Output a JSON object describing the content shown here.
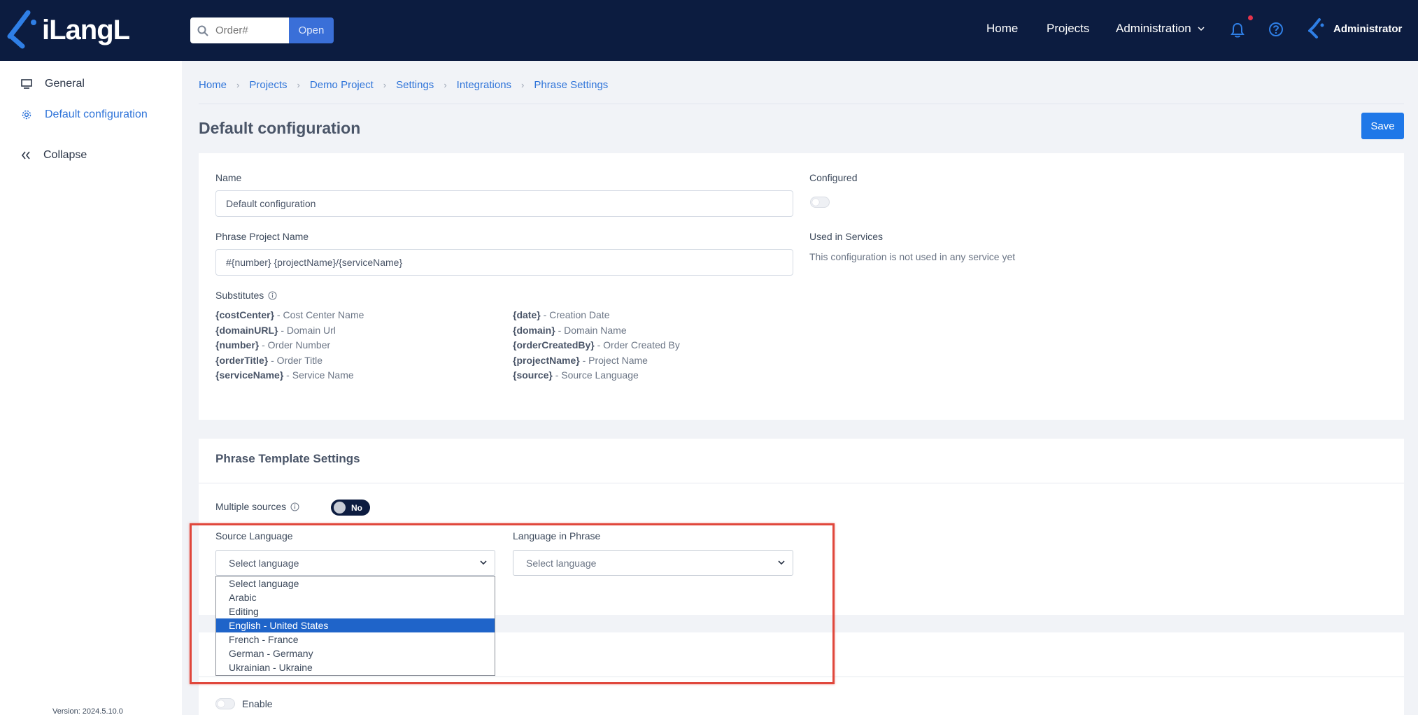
{
  "app": {
    "logo_text": "iLangL"
  },
  "header": {
    "search_placeholder": "Order#",
    "open_label": "Open",
    "nav": {
      "home": "Home",
      "projects": "Projects",
      "administration": "Administration"
    },
    "user_name": "Administrator"
  },
  "sidebar": {
    "items": [
      {
        "label": "General",
        "icon": "monitor-icon"
      },
      {
        "label": "Default configuration",
        "icon": "gear-icon"
      },
      {
        "label": "Collapse",
        "icon": "double-chevron-left-icon"
      }
    ],
    "version": "Version: 2024.5.10.0"
  },
  "breadcrumb": [
    "Home",
    "Projects",
    "Demo Project",
    "Settings",
    "Integrations",
    "Phrase Settings"
  ],
  "page": {
    "title": "Default configuration",
    "save_label": "Save"
  },
  "config": {
    "name_label": "Name",
    "name_value": "Default configuration",
    "configured_label": "Configured",
    "project_name_label": "Phrase Project Name",
    "project_name_value": "#{number} {projectName}/{serviceName}",
    "used_in_label": "Used in Services",
    "used_in_text": "This configuration is not used in any service yet",
    "substitutes_label": "Substitutes",
    "substitutes_left": [
      {
        "key": "{costCenter}",
        "desc": " - Cost Center Name"
      },
      {
        "key": "{domainURL}",
        "desc": " - Domain Url"
      },
      {
        "key": "{number}",
        "desc": " - Order Number"
      },
      {
        "key": "{orderTitle}",
        "desc": " - Order Title"
      },
      {
        "key": "{serviceName}",
        "desc": " - Service Name"
      }
    ],
    "substitutes_right": [
      {
        "key": "{date}",
        "desc": " - Creation Date"
      },
      {
        "key": "{domain}",
        "desc": " - Domain Name"
      },
      {
        "key": "{orderCreatedBy}",
        "desc": " - Order Created By"
      },
      {
        "key": "{projectName}",
        "desc": " - Project Name"
      },
      {
        "key": "{source}",
        "desc": " - Source Language"
      }
    ]
  },
  "template": {
    "title": "Phrase Template Settings",
    "multiple_sources_label": "Multiple sources",
    "multiple_sources_value": "No",
    "source_language_label": "Source Language",
    "source_language_value": "Select language",
    "language_in_phrase_label": "Language in Phrase",
    "language_in_phrase_value": "Select language",
    "options": [
      "Select language",
      "Arabic",
      "Editing",
      "English - United States",
      "French - France",
      "German - Germany",
      "Ukrainian - Ukraine"
    ],
    "highlighted_option": "English - United States"
  },
  "next_section": {
    "enable_label": "Enable"
  },
  "colors": {
    "topbar": "#0c1c40",
    "accent": "#2f74d9",
    "save": "#1f78e8",
    "highlight": "#e0473c"
  }
}
